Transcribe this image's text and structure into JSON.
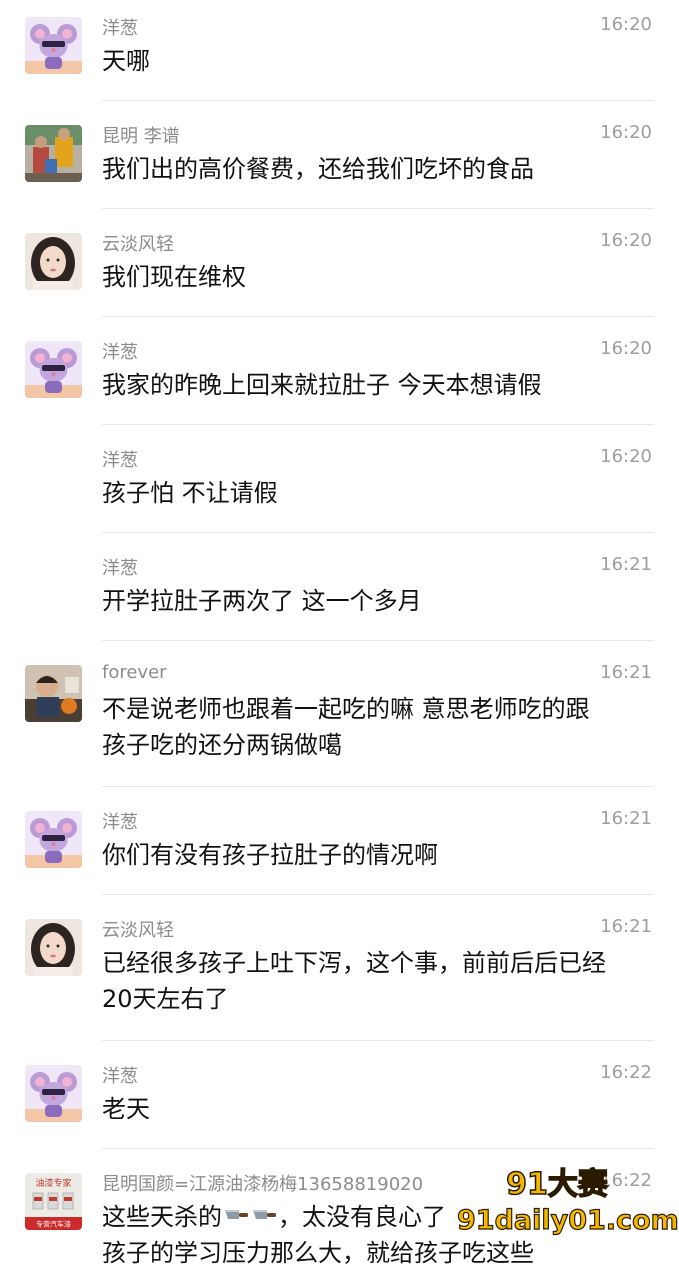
{
  "messages": [
    {
      "sender": "洋葱",
      "time": "16:20",
      "avatar": "mouse-avatar",
      "lines": [
        "天哪"
      ]
    },
    {
      "sender": "昆明 李谱",
      "time": "16:20",
      "avatar": "photo-avatar-family",
      "lines": [
        "我们出的高价餐费，还给我们吃坏的食品"
      ]
    },
    {
      "sender": "云淡风轻",
      "time": "16:20",
      "avatar": "photo-avatar-woman",
      "lines": [
        "我们现在维权"
      ]
    },
    {
      "sender": "洋葱",
      "time": "16:20",
      "avatar": "mouse-avatar",
      "lines": [
        "我家的昨晚上回来就拉肚子  今天本想请假"
      ]
    },
    {
      "sender": "洋葱",
      "time": "16:20",
      "avatar": "",
      "lines": [
        "孩子怕  不让请假"
      ]
    },
    {
      "sender": "洋葱",
      "time": "16:21",
      "avatar": "",
      "lines": [
        "开学拉肚子两次了    这一个多月"
      ]
    },
    {
      "sender": "forever",
      "time": "16:21",
      "avatar": "photo-avatar-child",
      "lines": [
        "不是说老师也跟着一起吃的嘛  意思老师吃的跟",
        "孩子吃的还分两锅做噶"
      ]
    },
    {
      "sender": "洋葱",
      "time": "16:21",
      "avatar": "mouse-avatar",
      "lines": [
        "你们有没有孩子拉肚子的情况啊"
      ]
    },
    {
      "sender": "云淡风轻",
      "time": "16:21",
      "avatar": "photo-avatar-woman",
      "lines": [
        "已经很多孩子上吐下泻，这个事，前前后后已经",
        "20天左右了"
      ]
    },
    {
      "sender": "洋葱",
      "time": "16:22",
      "avatar": "mouse-avatar",
      "lines": [
        "老天"
      ]
    },
    {
      "sender": "昆明国颜=江源油漆杨梅13658819020",
      "time": "16:22",
      "avatar": "paint-shop-avatar",
      "lines": [
        "这些天杀的",
        "，太没有良心了",
        "孩子的学习压力那么大，就给孩子吃这些"
      ]
    }
  ],
  "knife_emoji": "knife-icon",
  "paint_avatar_text": {
    "top": "油漆专家",
    "bottom": "专营汽车漆"
  },
  "watermark": {
    "top": "91大赛",
    "bottom": "91daily01.com"
  },
  "colors": {
    "sender": "#8c8c8c",
    "time": "#9e9e9e",
    "text": "#111111",
    "divider": "#e6e6e6",
    "watermark": "#f4b800"
  }
}
